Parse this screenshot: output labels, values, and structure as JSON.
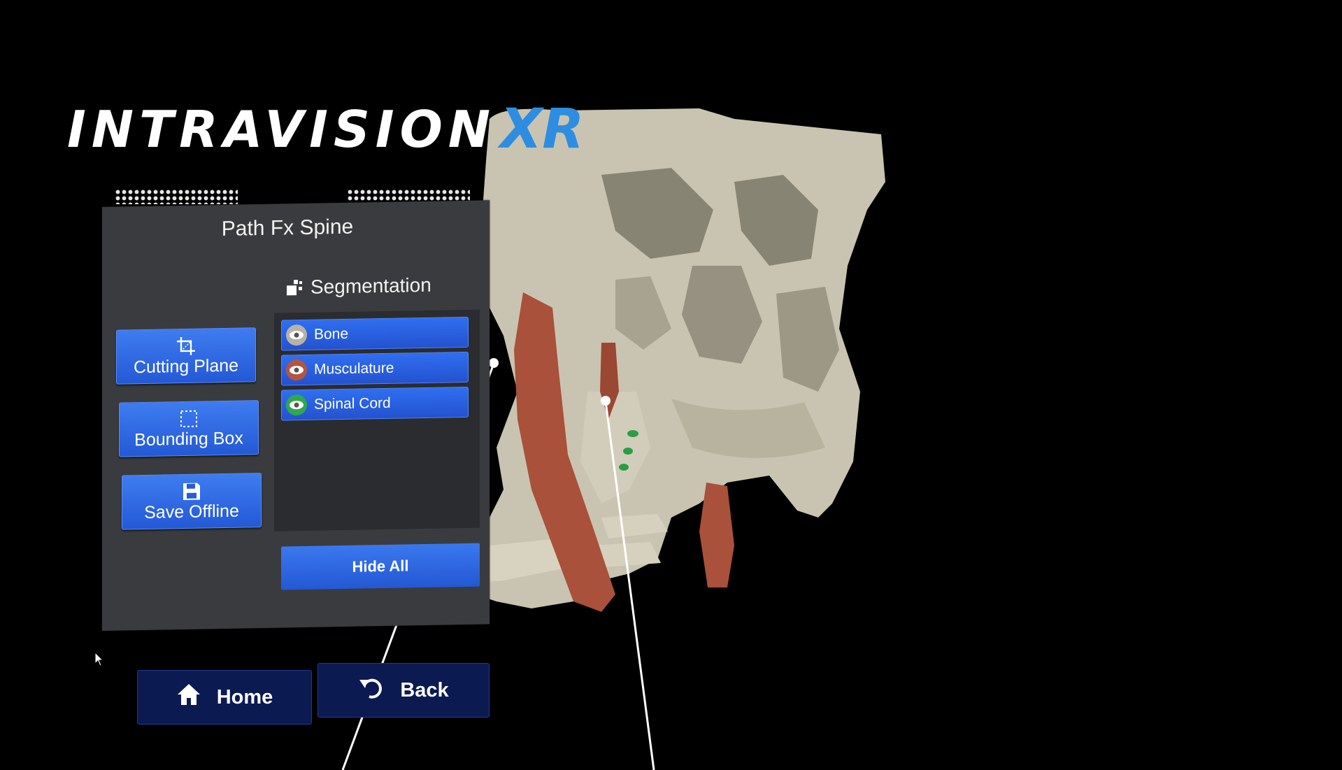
{
  "app": {
    "logo_main": "INTRAVISION",
    "logo_accent": "XR"
  },
  "panel": {
    "title": "Path Fx Spine",
    "tools": [
      {
        "label": "Cutting Plane",
        "icon": "crop-icon"
      },
      {
        "label": "Bounding Box",
        "icon": "bounding-box-icon"
      },
      {
        "label": "Save Offline",
        "icon": "save-icon"
      }
    ],
    "segmentation": {
      "header": "Segmentation",
      "items": [
        {
          "label": "Bone",
          "icon": "eye-icon",
          "color": "#b8b2a6"
        },
        {
          "label": "Musculature",
          "icon": "eye-icon",
          "color": "#b5553f"
        },
        {
          "label": "Spinal Cord",
          "icon": "eye-icon",
          "color": "#2fa84e"
        }
      ],
      "hide_all_label": "Hide All"
    }
  },
  "nav": {
    "home_label": "Home",
    "back_label": "Back"
  },
  "colors": {
    "panel_bg": "#3a3b3e",
    "button_blue": "#2e6cf0",
    "nav_bg": "#0c1a52",
    "bone": "#c9c4b2",
    "muscle": "#a9513a",
    "cord": "#2a9d45",
    "logo_accent": "#2e8de0"
  }
}
